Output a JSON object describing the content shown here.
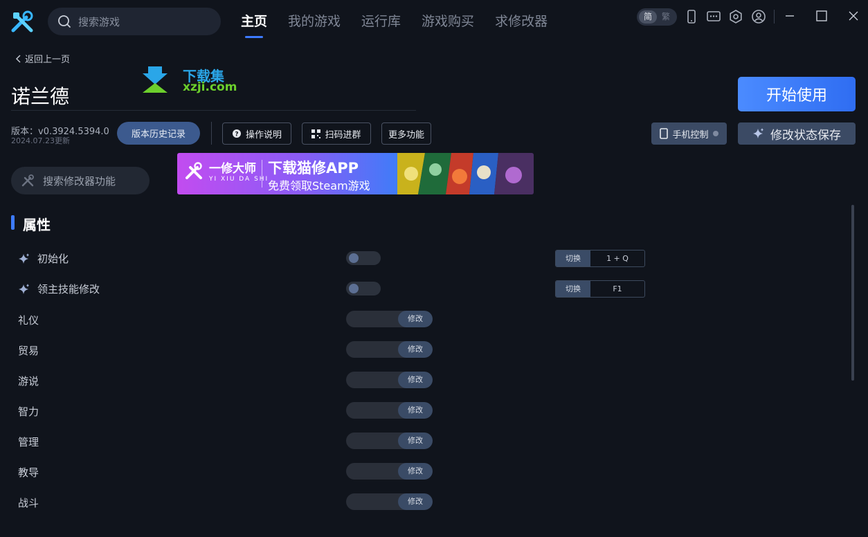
{
  "header": {
    "search_placeholder": "搜索游戏",
    "nav": [
      {
        "label": "主页",
        "active": true
      },
      {
        "label": "我的游戏",
        "active": false
      },
      {
        "label": "运行库",
        "active": false
      },
      {
        "label": "游戏购买",
        "active": false
      },
      {
        "label": "求修改器",
        "active": false
      }
    ],
    "lang_simplified": "简",
    "lang_traditional": "繁"
  },
  "page": {
    "back_label": "返回上一页",
    "game_title": "诺兰德",
    "watermark_title": "下载集",
    "watermark_url": "xzji.com",
    "start_button": "开始使用",
    "version": "版本：v0.3924.5394.0",
    "version_date": "2024.07.23更新",
    "history_button": "版本历史记录",
    "help_button": "操作说明",
    "qr_button": "扫码进群",
    "more_button": "更多功能",
    "phone_control": "手机控制",
    "save_state": "修改状态保存",
    "search_modifier_placeholder": "搜索修改器功能"
  },
  "banner": {
    "brand_name": "一修大师",
    "brand_sub": "YI XIU DA SHI",
    "title": "下载猫修APP",
    "subtitle": "免费领取Steam游戏"
  },
  "section": {
    "title": "属性",
    "toggles": [
      {
        "label": "初始化",
        "hotkey_label": "切换",
        "hotkey": "1 + Q"
      },
      {
        "label": "领主技能修改",
        "hotkey_label": "切换",
        "hotkey": "F1"
      }
    ],
    "attributes": [
      {
        "label": "礼仪",
        "button": "修改"
      },
      {
        "label": "贸易",
        "button": "修改"
      },
      {
        "label": "游说",
        "button": "修改"
      },
      {
        "label": "智力",
        "button": "修改"
      },
      {
        "label": "管理",
        "button": "修改"
      },
      {
        "label": "教导",
        "button": "修改"
      },
      {
        "label": "战斗",
        "button": "修改"
      }
    ]
  },
  "colors": {
    "accent": "#3d7bff",
    "background": "#10141c",
    "button_fill": "#3b4a64"
  }
}
